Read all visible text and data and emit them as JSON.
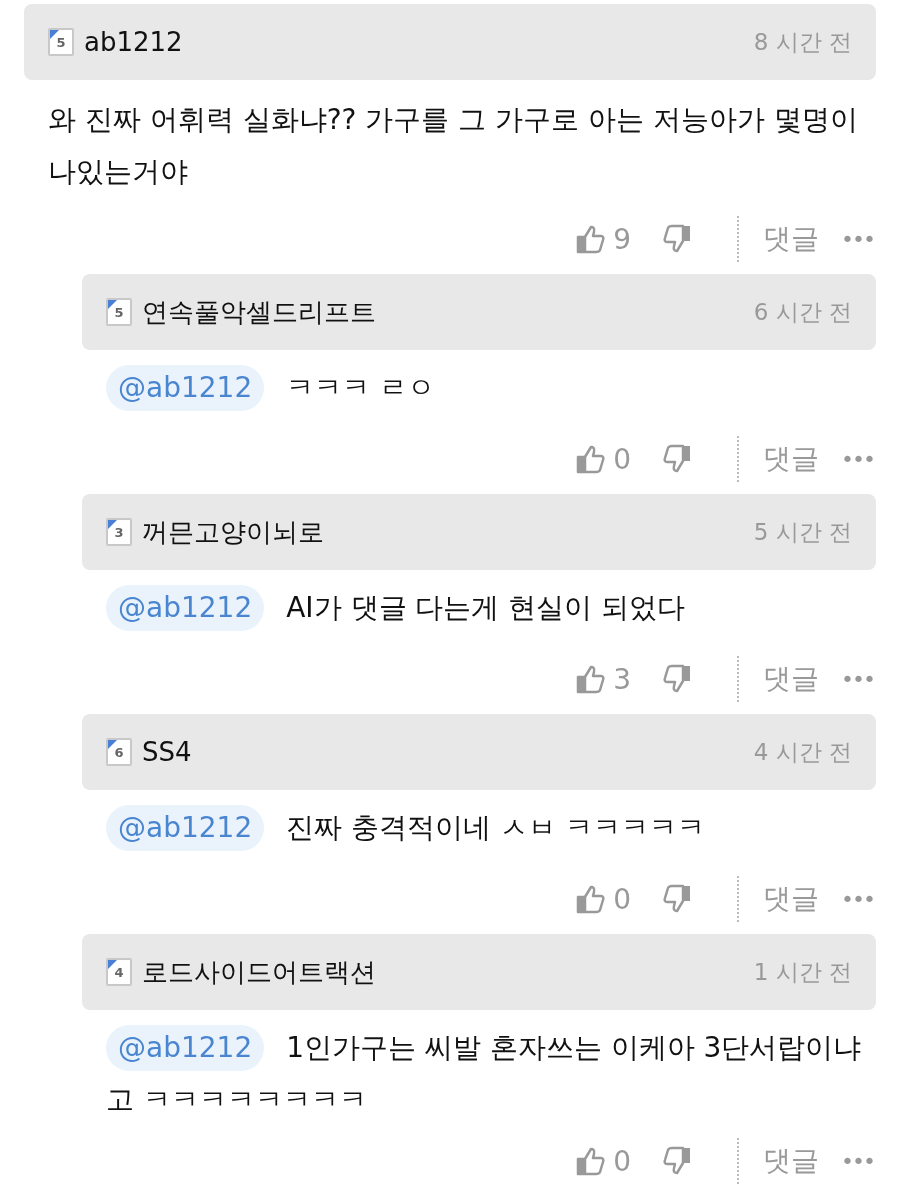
{
  "comment": {
    "user": "ab1212",
    "level": "5",
    "time": "8 시간 전",
    "text": "와 진짜 어휘력 실화냐?? 가구를 그 가구로 아는 저능아가 몇명이 나있는거야",
    "likes": "9",
    "reply_label": "댓글",
    "more": "•••"
  },
  "replies": [
    {
      "user": "연속풀악셀드리프트",
      "level": "5",
      "time": "6 시간 전",
      "mention": "@ab1212",
      "text": "ㅋㅋㅋ ㄹㅇ",
      "likes": "0",
      "reply_label": "댓글",
      "more": "•••"
    },
    {
      "user": "꺼믄고양이뇌로",
      "level": "3",
      "time": "5 시간 전",
      "mention": "@ab1212",
      "text": "AI가 댓글 다는게 현실이 되었다",
      "likes": "3",
      "reply_label": "댓글",
      "more": "•••"
    },
    {
      "user": "SS4",
      "level": "6",
      "time": "4 시간 전",
      "mention": "@ab1212",
      "text": "진짜 충격적이네 ㅅㅂ ㅋㅋㅋㅋㅋ",
      "likes": "0",
      "reply_label": "댓글",
      "more": "•••"
    },
    {
      "user": "로드사이드어트랙션",
      "level": "4",
      "time": "1 시간 전",
      "mention": "@ab1212",
      "text": "1인가구는 씨발 혼자쓰는 이케아 3단서랍이냐",
      "text_cont": "고 ㅋㅋㅋㅋㅋㅋㅋㅋ",
      "likes": "0",
      "reply_label": "댓글",
      "more": "•••"
    }
  ]
}
